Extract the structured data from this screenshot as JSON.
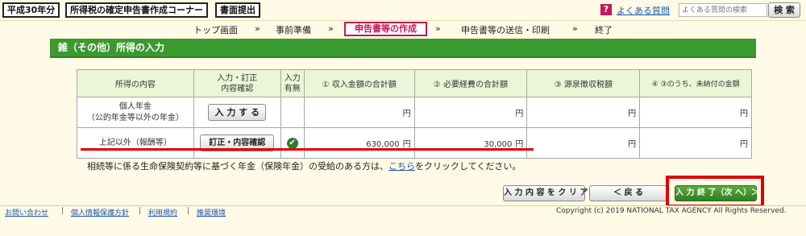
{
  "header": {
    "year_label": "平成30年分",
    "app_title": "所得税の確定申告書作成コーナー",
    "submit_label": "書面提出",
    "help_icon_glyph": "?",
    "faq_link": "よくある質問",
    "search_placeholder": "よくある質問の検索",
    "search_button": "検 索"
  },
  "steps": {
    "items": [
      "トップ画面",
      "事前準備",
      "申告書等の作成",
      "申告書等の送信・印刷",
      "終了"
    ],
    "separator": "»",
    "current_index": 2
  },
  "section": {
    "title": "雑（その他）所得の入力"
  },
  "table": {
    "headers": [
      "所得の内容",
      "入力・訂正\n内容確認",
      "入力\n有無",
      "① 収入金額の合計額",
      "② 必要経費の合計額",
      "③ 源泉徴収税額",
      "④ ③のうち、未納付の金額"
    ],
    "rows": [
      {
        "name": "個人年金\n（公的年金等以外の年金）",
        "button": "入 力 す る",
        "entered": false,
        "income": "",
        "expenses": "",
        "withholding": "",
        "unpaid": ""
      },
      {
        "name": "上記以外（報酬等）",
        "button": "訂正・内容確認",
        "entered": true,
        "income": "630,000",
        "expenses": "30,000",
        "withholding": "",
        "unpaid": ""
      }
    ],
    "yen": "円"
  },
  "note": {
    "text_before": "相続等に係る生命保険契約等に基づく年金（保険年金）の受給のある方は、",
    "link": "こちら",
    "text_after": "をクリックしてください。"
  },
  "actions": {
    "clear": "入 力 内 容 を ク リ ア",
    "back": "＜ 戻 る",
    "next": "入 力 終 了（次 へ）＞"
  },
  "footer": {
    "links": [
      "お問い合わせ",
      "個人情報保護方針",
      "利用規約",
      "推奨環境"
    ],
    "separator": "|",
    "copyright": "Copyright (c) 2019 NATIONAL TAX AGENCY All Rights Reserved."
  },
  "colors": {
    "accent_green": "#3a9a2f",
    "highlight_red": "#e00000",
    "current_step": "#c2185b",
    "link_blue": "#1a56b6"
  }
}
